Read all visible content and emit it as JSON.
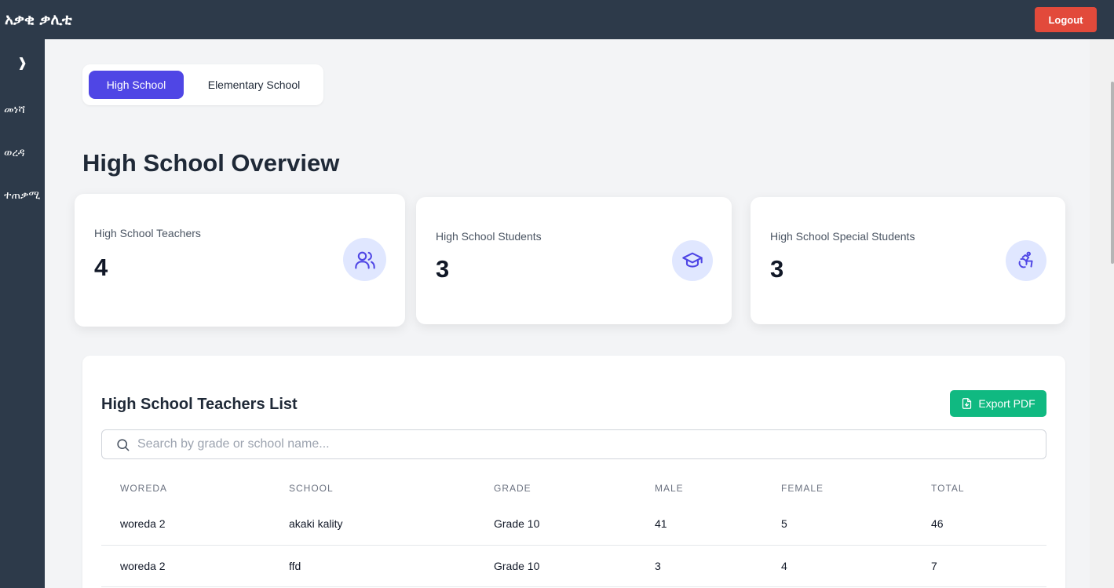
{
  "app": {
    "title": "አቃቂ ቃሊቲ",
    "logout_label": "Logout"
  },
  "sidebar": {
    "toggle": "❱",
    "items": [
      {
        "label": "መነሻ"
      },
      {
        "label": "ወረዳ"
      },
      {
        "label": "ተጠቃሚ"
      }
    ]
  },
  "tabs": [
    {
      "label": "High School",
      "active": true
    },
    {
      "label": "Elementary School",
      "active": false
    }
  ],
  "page_title": "High School Overview",
  "stats": [
    {
      "label": "High School Teachers",
      "value": "4",
      "icon": "users-icon"
    },
    {
      "label": "High School Students",
      "value": "3",
      "icon": "graduation-cap-icon"
    },
    {
      "label": "High School Special Students",
      "value": "3",
      "icon": "accessibility-icon"
    }
  ],
  "teachers_list": {
    "title": "High School Teachers List",
    "export_label": "Export PDF",
    "search_placeholder": "Search by grade or school name...",
    "columns": [
      "WOREDA",
      "SCHOOL",
      "GRADE",
      "MALE",
      "FEMALE",
      "TOTAL"
    ],
    "rows": [
      [
        "woreda 2",
        "akaki kality",
        "Grade 10",
        "41",
        "5",
        "46"
      ],
      [
        "woreda 2",
        "ffd",
        "Grade 10",
        "3",
        "4",
        "7"
      ]
    ]
  },
  "colors": {
    "navbar": "#2d3a4a",
    "accent": "#4f46e5",
    "logout": "#e24a3b",
    "export": "#10b981",
    "icon_bg": "#e0e7ff"
  }
}
